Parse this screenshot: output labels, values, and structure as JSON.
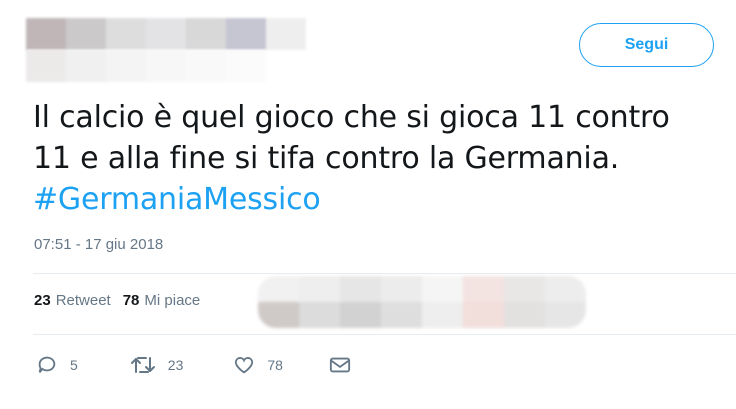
{
  "header": {
    "follow_label": "Segui"
  },
  "tweet": {
    "text_line1": "Il calcio è quel gioco che si gioca 11 contro",
    "text_line2": "11 e alla fine si tifa contro la Germania.",
    "hashtag": "#GermaniaMessico",
    "timestamp": "07:51 - 17 giu 2018"
  },
  "stats": {
    "retweets_count": "23",
    "retweets_label": "Retweet",
    "likes_count": "78",
    "likes_label": "Mi piace"
  },
  "actions": {
    "reply_count": "5",
    "retweet_count": "23",
    "like_count": "78"
  },
  "icons": [
    "reply-icon",
    "retweet-icon",
    "like-icon",
    "message-icon"
  ],
  "colors": {
    "accent": "#1da1f2",
    "muted": "#657786",
    "text": "#14171a",
    "divider": "#e6ecf0"
  }
}
